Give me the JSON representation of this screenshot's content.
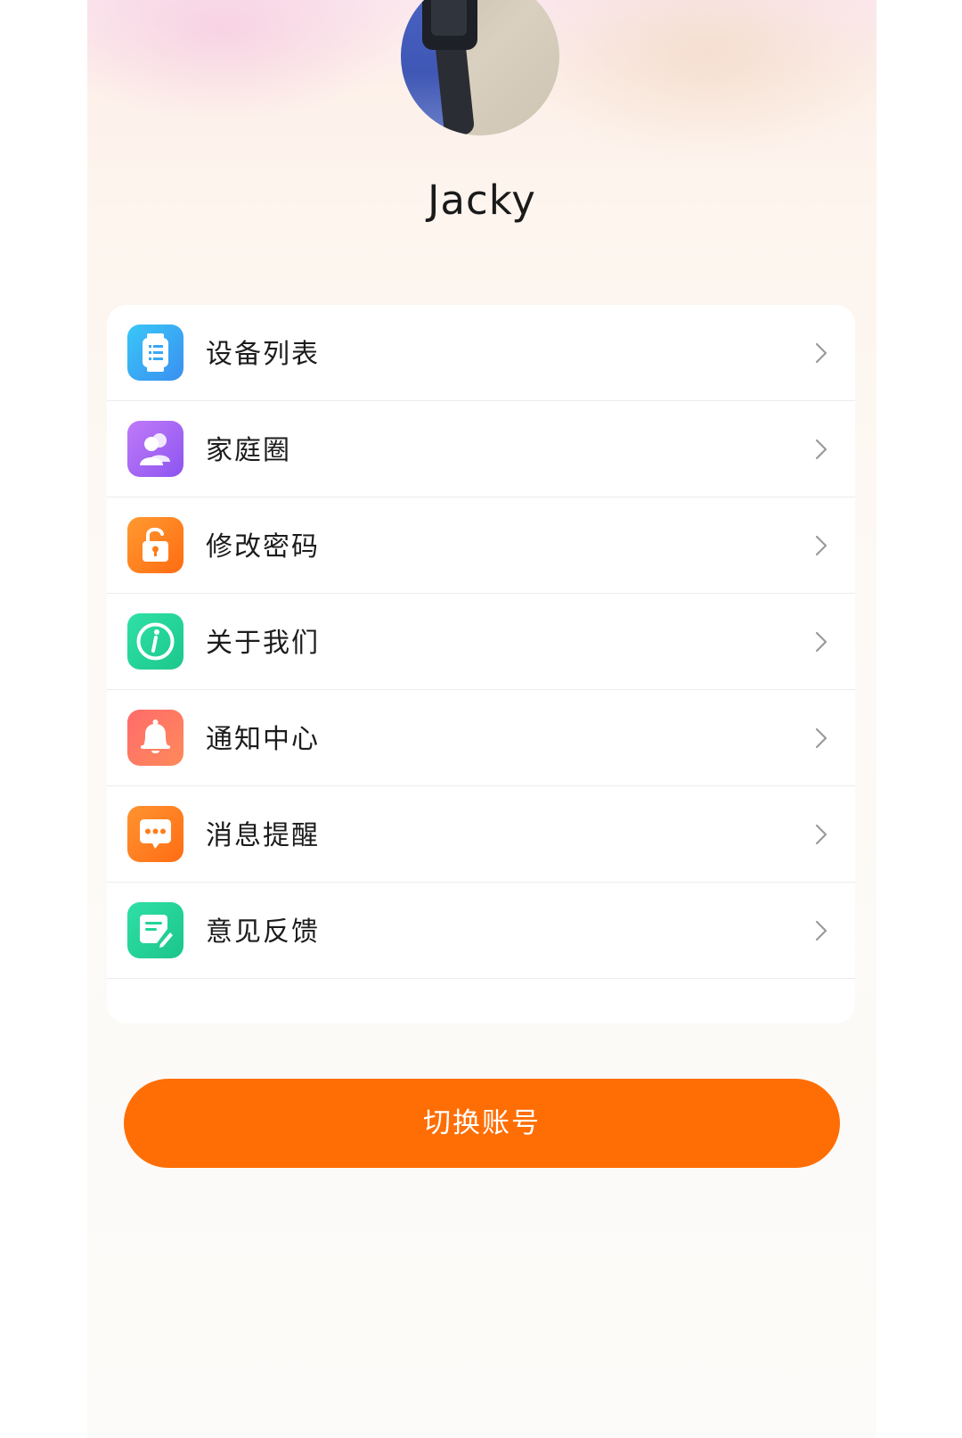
{
  "profile": {
    "username": "Jacky"
  },
  "menu": {
    "items": [
      {
        "label": "设备列表",
        "icon": "watch-list-icon",
        "color": "#3fb1f5"
      },
      {
        "label": "家庭圈",
        "icon": "family-icon",
        "color": "#a163f0"
      },
      {
        "label": "修改密码",
        "icon": "unlock-icon",
        "color": "#ff7d1a"
      },
      {
        "label": "关于我们",
        "icon": "info-icon",
        "color": "#25d39a"
      },
      {
        "label": "通知中心",
        "icon": "bell-icon",
        "color": "#ff5a5a"
      },
      {
        "label": "消息提醒",
        "icon": "message-icon",
        "color": "#ff7a1c"
      },
      {
        "label": "意见反馈",
        "icon": "feedback-icon",
        "color": "#22d49a"
      }
    ]
  },
  "actions": {
    "switch_account": "切换账号"
  },
  "colors": {
    "accent": "#ff6e05"
  }
}
